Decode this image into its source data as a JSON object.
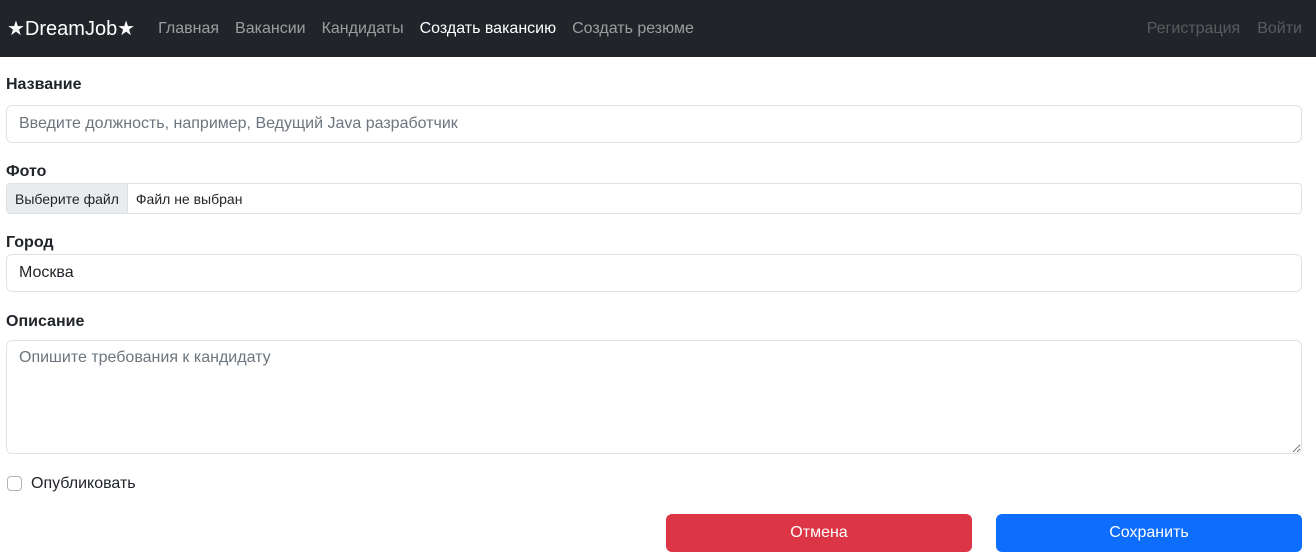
{
  "navbar": {
    "brand": "★DreamJob★",
    "links": [
      "Главная",
      "Вакансии",
      "Кандидаты",
      "Создать вакансию",
      "Создать резюме"
    ],
    "auth": [
      "Регистрация",
      "Войти"
    ]
  },
  "form": {
    "title_label": "Название",
    "title_placeholder": "Введите должность, например, Ведущий Java разработчик",
    "photo_label": "Фото",
    "file_button": "Выберите файл",
    "file_status": "Файл не выбран",
    "city_label": "Город",
    "city_value": "Москва",
    "description_label": "Описание",
    "description_placeholder": "Опишите требования к кандидату",
    "publish_label": "Опубликовать",
    "cancel_label": "Отмена",
    "save_label": "Сохранить"
  },
  "colors": {
    "navbar_bg": "#212529",
    "cancel": "#dc3545",
    "save": "#0d6efd"
  }
}
